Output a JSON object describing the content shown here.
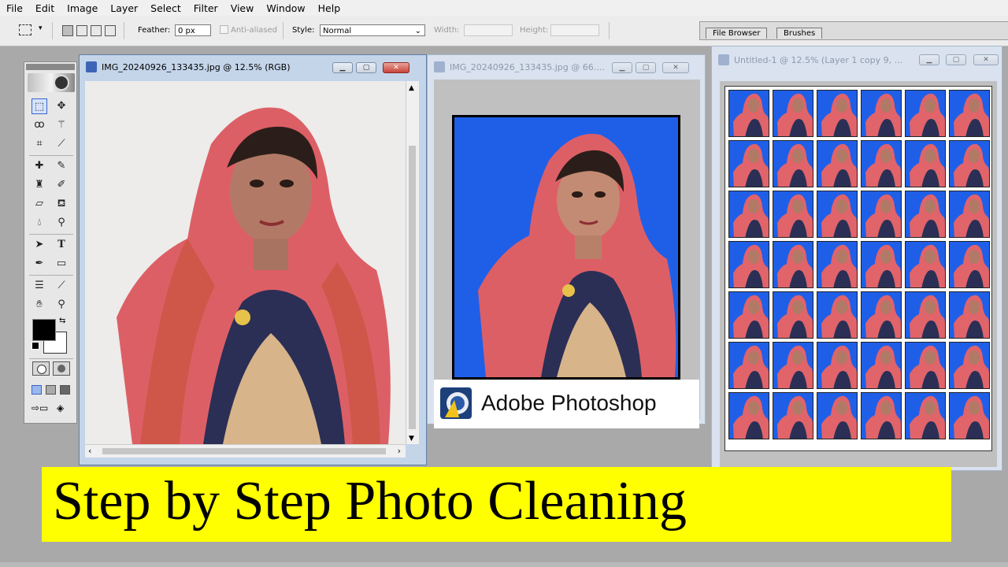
{
  "menu": [
    "File",
    "Edit",
    "Image",
    "Layer",
    "Select",
    "Filter",
    "View",
    "Window",
    "Help"
  ],
  "options_bar": {
    "feather_label": "Feather:",
    "feather_value": "0 px",
    "anti_aliased_label": "Anti-aliased",
    "style_label": "Style:",
    "style_value": "Normal",
    "width_label": "Width:",
    "height_label": "Height:"
  },
  "palette_tabs": [
    "File Browser",
    "Brushes"
  ],
  "windows": {
    "original": {
      "title": "IMG_20240926_133435.jpg @ 12.5% (RGB)"
    },
    "edited": {
      "title": "IMG_20240926_133435.jpg @ 66...."
    },
    "sheet": {
      "title": "Untitled-1 @ 12.5% (Layer 1 copy 9, ...",
      "rows": 7,
      "cols": 6
    }
  },
  "logo": {
    "text": "Adobe Photoshop"
  },
  "banner": {
    "text": "Step by Step Photo Cleaning"
  },
  "colors": {
    "photo_background": "#1f5fe8",
    "banner_yellow": "#ffff00",
    "dupatta": "#e0646a",
    "skin": "#b07a66",
    "window_frame": "#c4d5ea"
  },
  "icons": {
    "tools": [
      "marquee-icon",
      "move-icon",
      "lasso-icon",
      "magic-wand-icon",
      "crop-icon",
      "slice-icon",
      "healing-brush-icon",
      "brush-icon",
      "clone-stamp-icon",
      "history-brush-icon",
      "eraser-icon",
      "paint-bucket-icon",
      "blur-icon",
      "dodge-icon",
      "path-select-icon",
      "type-icon",
      "pen-icon",
      "shape-icon",
      "notes-icon",
      "eyedropper-icon",
      "hand-icon",
      "zoom-icon"
    ]
  }
}
